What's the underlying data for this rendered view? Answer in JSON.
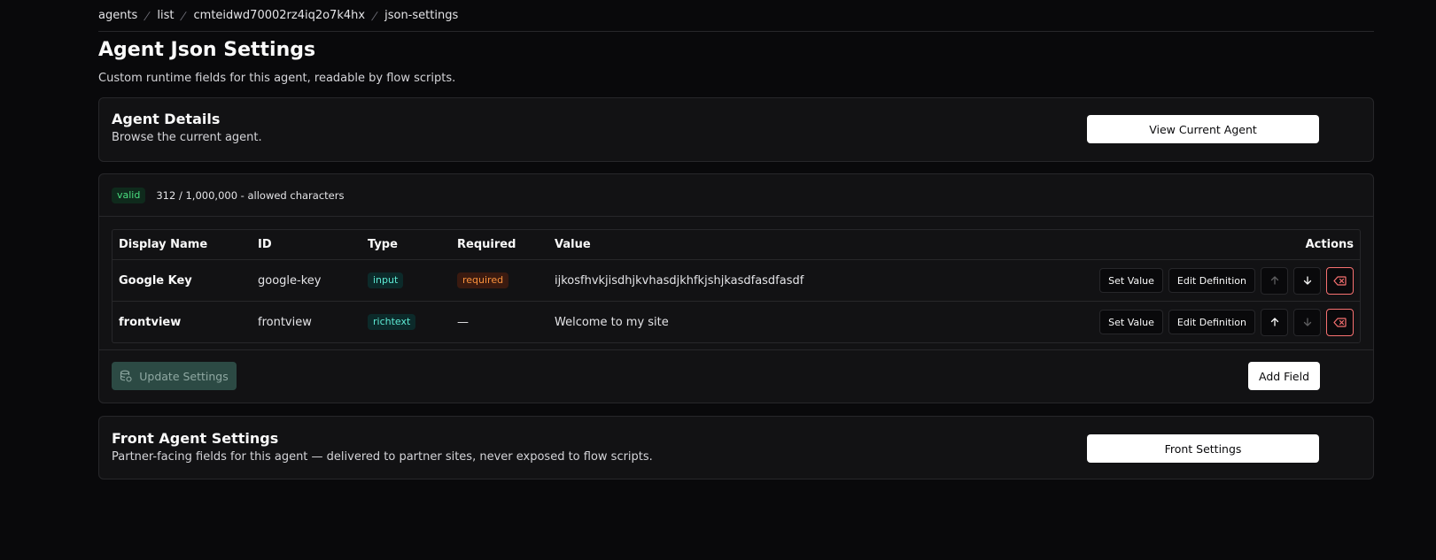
{
  "breadcrumb": [
    "agents",
    "list",
    "cmteidwd70002rz4iq2o7k4hx",
    "json-settings"
  ],
  "page": {
    "title": "Agent Json Settings",
    "subtitle": "Custom runtime fields for this agent, readable by flow scripts."
  },
  "agent_details": {
    "title": "Agent Details",
    "description": "Browse the current agent.",
    "button_label": "View Current Agent"
  },
  "json_editor": {
    "status_badge": "valid",
    "char_count": "312 / 1,000,000 - allowed characters",
    "columns": {
      "display_name": "Display Name",
      "id": "ID",
      "type": "Type",
      "required": "Required",
      "value": "Value",
      "actions": "Actions"
    },
    "rows": [
      {
        "display_name": "Google Key",
        "id": "google-key",
        "type": "input",
        "required": "required",
        "value": "ijkosfhvkjisdhjkvhasdjkhfkjshjkasdfasdfasdf",
        "set_value_label": "Set Value",
        "edit_definition_label": "Edit Definition"
      },
      {
        "display_name": "frontview",
        "id": "frontview",
        "type": "richtext",
        "required": "—",
        "value": "Welcome to my site",
        "set_value_label": "Set Value",
        "edit_definition_label": "Edit Definition"
      }
    ],
    "update_button_label": "Update Settings",
    "add_field_label": "Add Field"
  },
  "front_settings": {
    "title": "Front Agent Settings",
    "description": "Partner-facing fields for this agent — delivered to partner sites, never exposed to flow scripts.",
    "button_label": "Front Settings"
  },
  "colors": {
    "background": "#09090b",
    "card": "#121214",
    "border": "#27272a",
    "valid": "#4ade80",
    "danger": "#f87171",
    "update_button": "#2c4a44"
  }
}
